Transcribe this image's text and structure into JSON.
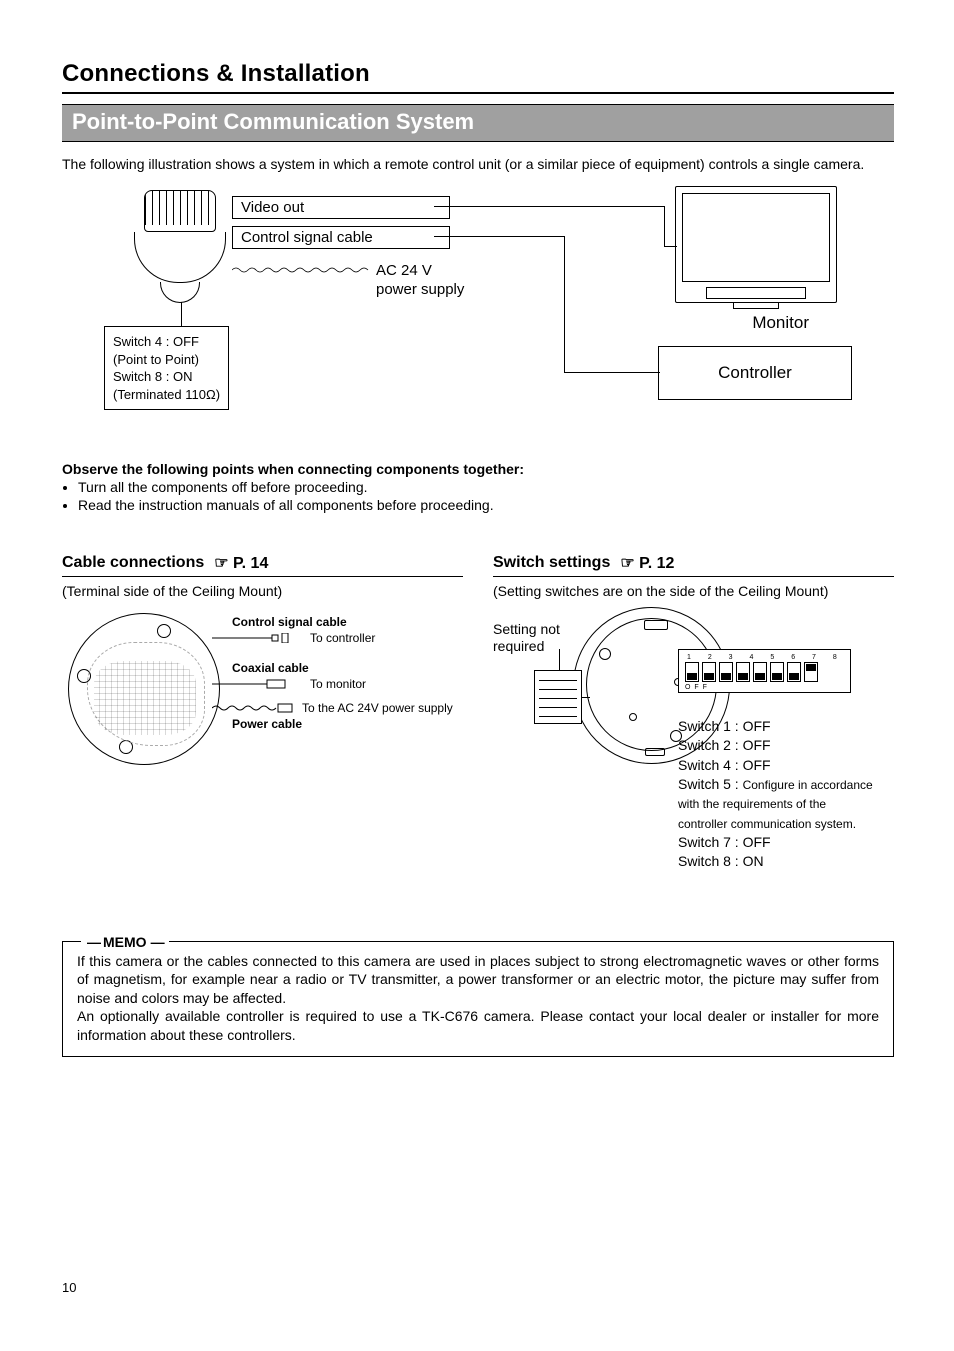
{
  "headings": {
    "main": "Connections & Installation",
    "banner": "Point-to-Point Communication System"
  },
  "intro": "The following illustration shows a system in which a remote control unit (or a similar piece of equipment) controls a single camera.",
  "diagram": {
    "video_out": "Video out",
    "control_signal": "Control signal cable",
    "ac": "AC 24 V",
    "power_supply": "power supply",
    "monitor": "Monitor",
    "controller": "Controller",
    "switch_box": {
      "l1": "Switch 4 : OFF",
      "l2": "(Point to Point)",
      "l3": "Switch 8 : ON",
      "l4": "(Terminated 110Ω)"
    }
  },
  "observe": {
    "heading": "Observe the following points when connecting components together:",
    "b1": "Turn all the components off before proceeding.",
    "b2": "Read the instruction manuals of all components before proceeding."
  },
  "cable": {
    "heading": "Cable connections",
    "ref": "☞  P. 14",
    "sub": "(Terminal side of the Ceiling Mount)",
    "control_signal": "Control signal cable",
    "to_controller": "To controller",
    "coax": "Coaxial cable",
    "to_monitor": "To monitor",
    "to_ac": "To the AC 24V power supply",
    "power_cable": "Power cable"
  },
  "switches": {
    "heading": "Switch settings",
    "ref": "☞  P. 12",
    "sub": "(Setting switches are on the side of the Ceiling Mount)",
    "setting_not": "Setting not",
    "required": "required",
    "dip_nums": "1 2 3 4 5 6 7 8",
    "dip_off": "O F F",
    "list": {
      "s1": "Switch 1 : OFF",
      "s2": "Switch 2 : OFF",
      "s4": "Switch 4 : OFF",
      "s5a": "Switch 5 :",
      "s5b": "Configure in accordance with the requirements of the controller communication system.",
      "s7": "Switch 7 : OFF",
      "s8": "Switch 8 : ON"
    }
  },
  "memo": {
    "label": "MEMO",
    "p1": "If this camera or the cables connected to this camera are used in places subject to strong electromagnetic waves or other forms of magnetism, for example near a radio or TV transmitter, a power transformer or an electric motor, the picture may suffer from noise and colors may be affected.",
    "p2": "An optionally available controller is required to use a TK-C676 camera.  Please contact your local dealer or installer for more information about these controllers."
  },
  "page_number": "10"
}
